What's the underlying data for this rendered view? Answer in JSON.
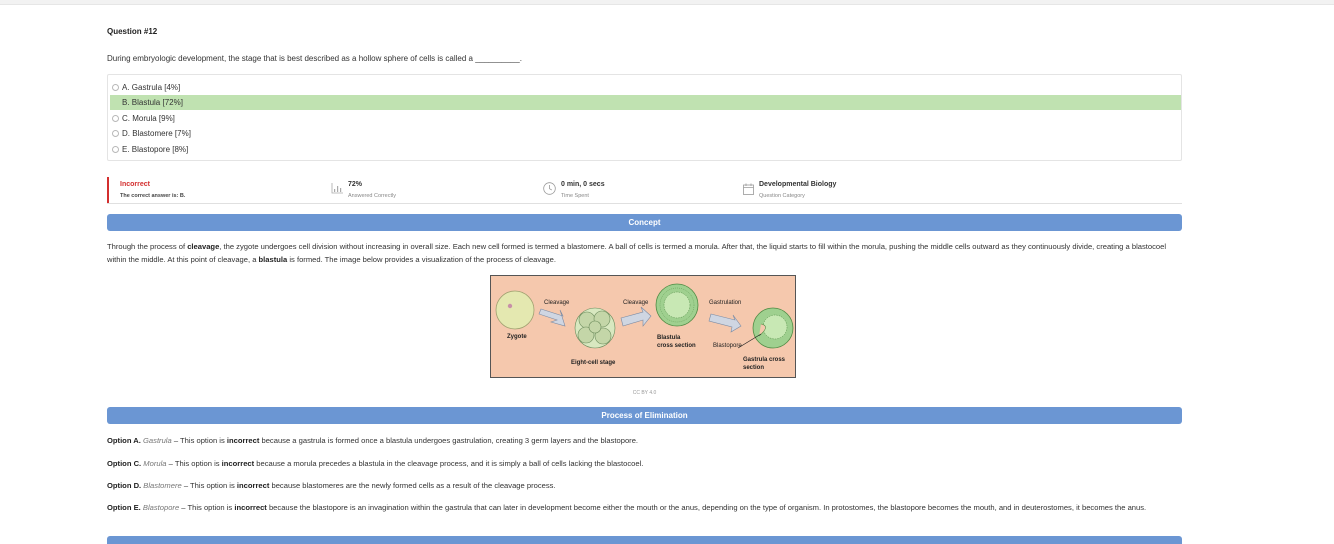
{
  "question": {
    "number_label": "Question #12",
    "text": "During embryologic development, the stage that is best described as a hollow sphere of cells is called a __________."
  },
  "choices": [
    {
      "label": "A. Gastrula [4%]",
      "correct": false
    },
    {
      "label": "B. Blastula [72%]",
      "correct": true
    },
    {
      "label": "C. Morula [9%]",
      "correct": false
    },
    {
      "label": "D. Blastomere [7%]",
      "correct": false
    },
    {
      "label": "E. Blastopore [8%]",
      "correct": false
    }
  ],
  "stats": {
    "result": "Incorrect",
    "correct_answer": "The correct answer is: B.",
    "percent": "72%",
    "percent_label": "Answered Correctly",
    "time": "0 min, 0 secs",
    "time_label": "Time Spent",
    "category": "Developmental Biology",
    "category_label": "Question Category"
  },
  "concept": {
    "heading": "Concept",
    "p1_a": "Through the process of ",
    "p1_b1": "cleavage",
    "p1_c": ", the zygote undergoes cell division without increasing in overall size. Each new cell formed is termed a blastomere. A ball of cells is termed a morula. After that, the liquid starts to fill within the morula, pushing the middle cells outward as they continuously divide, creating a blastocoel within the middle. At this point of cleavage, a ",
    "p1_b2": "blastula",
    "p1_d": " is formed. The image below provides a visualization of the process of cleavage."
  },
  "figure": {
    "zygote": "Zygote",
    "cleavage1": "Cleavage",
    "cleavage2": "Cleavage",
    "gastrulation": "Gastrulation",
    "eight_cell": "Eight-cell stage",
    "blastula_cs_1": "Blastula",
    "blastula_cs_2": "cross section",
    "blastopore": "Blastopore",
    "gastrula_cs_1": "Gastrula cross",
    "gastrula_cs_2": "section",
    "credit": "CC BY 4.0",
    "colors": {
      "background": "#f5c8ad",
      "zygote": "#e4e8b0",
      "blastula": "#9fd08f"
    }
  },
  "elimination": {
    "heading": "Process of Elimination",
    "items": [
      {
        "opt": "Option A.",
        "term": "Gastrula",
        "pre": " – This option is ",
        "bold": "incorrect",
        "post": " because a gastrula is formed once a blastula undergoes gastrulation, creating 3 germ layers and the blastopore."
      },
      {
        "opt": "Option C.",
        "term": "Morula",
        "pre": " – This option is ",
        "bold": "incorrect",
        "post": " because a morula precedes a blastula in the cleavage process, and it is simply a ball of cells lacking the blastocoel."
      },
      {
        "opt": "Option D.",
        "term": "Blastomere",
        "pre": " – This option is ",
        "bold": "incorrect",
        "post": " because blastomeres are the newly formed cells as a result of the cleavage process."
      },
      {
        "opt": "Option E.",
        "term": "Blastopore",
        "pre": " – This option is ",
        "bold": "incorrect",
        "post": " because the blastopore is an invagination within the gastrula that can later in development become either the mouth or the anus, depending on the type of organism. In protostomes, the blastopore becomes the mouth, and in deuterostomes, it becomes the anus."
      }
    ]
  },
  "colors": {
    "accent": "#6b96d3",
    "correct_bg": "#c0e2b1",
    "incorrect": "#d32f2f"
  }
}
